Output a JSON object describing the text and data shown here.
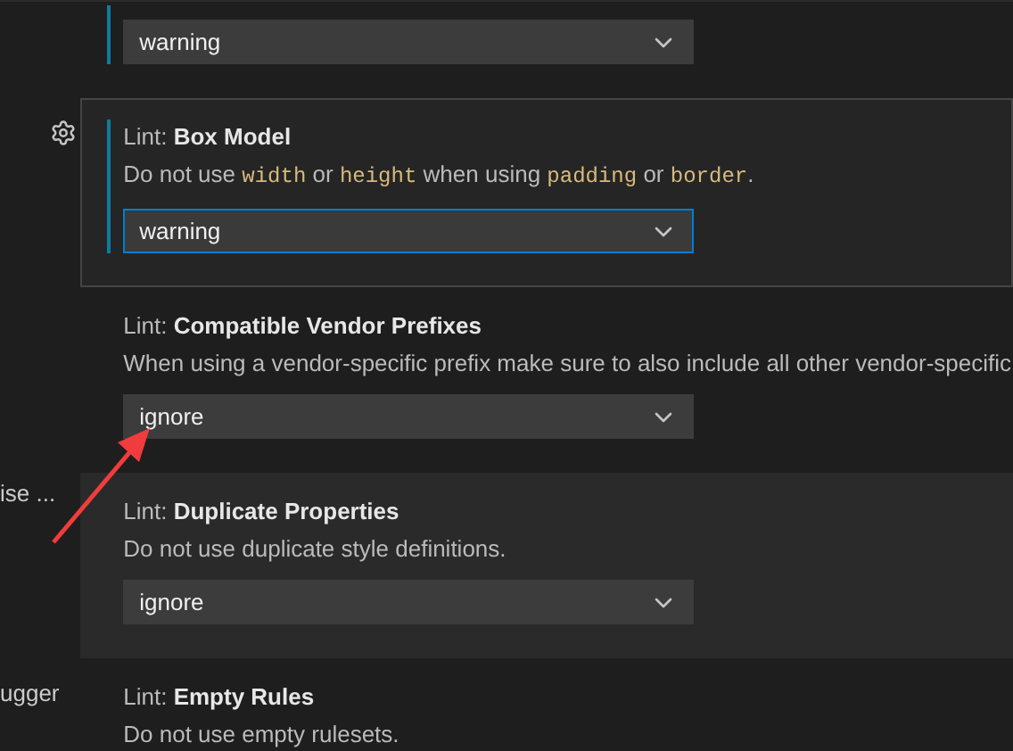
{
  "sidebar": {
    "items": [
      {
        "label": "ise ..."
      },
      {
        "label": "ugger"
      }
    ]
  },
  "settings": [
    {
      "value": "warning",
      "modified": true,
      "focused": false,
      "hovered": false,
      "dropdown_focused": false
    },
    {
      "category": "Lint: ",
      "title": "Box Model",
      "description": [
        {
          "kind": "text",
          "text": "Do not use "
        },
        {
          "kind": "code",
          "text": "width"
        },
        {
          "kind": "text",
          "text": " or "
        },
        {
          "kind": "code",
          "text": "height"
        },
        {
          "kind": "text",
          "text": " when using "
        },
        {
          "kind": "code",
          "text": "padding"
        },
        {
          "kind": "text",
          "text": " or "
        },
        {
          "kind": "code",
          "text": "border"
        },
        {
          "kind": "text",
          "text": "."
        }
      ],
      "value": "warning",
      "modified": true,
      "focused": true,
      "hovered": false,
      "dropdown_focused": true
    },
    {
      "category": "Lint: ",
      "title": "Compatible Vendor Prefixes",
      "description": [
        {
          "kind": "text",
          "text": "When using a vendor-specific prefix make sure to also include all other vendor-specific"
        }
      ],
      "value": "ignore",
      "modified": false,
      "focused": false,
      "hovered": false,
      "dropdown_focused": false
    },
    {
      "category": "Lint: ",
      "title": "Duplicate Properties",
      "description": [
        {
          "kind": "text",
          "text": "Do not use duplicate style definitions."
        }
      ],
      "value": "ignore",
      "modified": false,
      "focused": false,
      "hovered": true,
      "dropdown_focused": false
    },
    {
      "category": "Lint: ",
      "title": "Empty Rules",
      "description": [
        {
          "kind": "text",
          "text": "Do not use empty rulesets."
        }
      ],
      "modified": false,
      "focused": false,
      "hovered": false
    }
  ]
}
